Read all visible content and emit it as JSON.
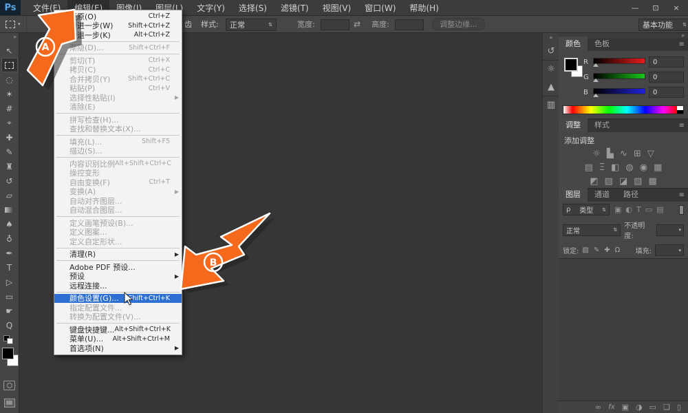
{
  "colors": {
    "accent_orange": "#f4691b",
    "menu_highlight": "#2e6fd2",
    "ui_dark": "#3c3c3c"
  },
  "titlebar": {
    "logo": "Ps",
    "menus": [
      {
        "label": "文件(F)",
        "cls": ""
      },
      {
        "label": "编辑(E)",
        "cls": "active"
      },
      {
        "label": "图像(I)",
        "cls": ""
      },
      {
        "label": "图层(L)",
        "cls": ""
      },
      {
        "label": "文字(Y)",
        "cls": ""
      },
      {
        "label": "选择(S)",
        "cls": ""
      },
      {
        "label": "滤镜(T)",
        "cls": ""
      },
      {
        "label": "视图(V)",
        "cls": ""
      },
      {
        "label": "窗口(W)",
        "cls": ""
      },
      {
        "label": "帮助(H)",
        "cls": ""
      }
    ],
    "minimize": "—",
    "restore": "⊡",
    "close": "×"
  },
  "options_bar": {
    "antialias_fragment": "齿",
    "style_label": "样式:",
    "style_value": "正常",
    "width_label": "宽度:",
    "height_label": "高度:",
    "swap_icon": "⇄",
    "refine_edge_button": "调整边缘...",
    "workspace_value": "基本功能",
    "select_arrows": "⇅",
    "dropdown_arrow": "▾"
  },
  "toolbar": {
    "collapse_glyph": "»",
    "tools": [
      {
        "name": "move-tool",
        "glyph": "↖",
        "cls": ""
      },
      {
        "name": "rectangular-marquee-tool",
        "glyph": "",
        "cls": "marquee selected"
      },
      {
        "name": "lasso-tool",
        "glyph": "◌",
        "cls": ""
      },
      {
        "name": "quick-selection-tool",
        "glyph": "✶",
        "cls": ""
      },
      {
        "name": "crop-tool",
        "glyph": "#",
        "cls": ""
      },
      {
        "name": "eyedropper-tool",
        "glyph": "⌖",
        "cls": ""
      },
      {
        "name": "spot-healing-brush-tool",
        "glyph": "✚",
        "cls": ""
      },
      {
        "name": "brush-tool",
        "glyph": "✎",
        "cls": ""
      },
      {
        "name": "clone-stamp-tool",
        "glyph": "♜",
        "cls": ""
      },
      {
        "name": "history-brush-tool",
        "glyph": "↺",
        "cls": ""
      },
      {
        "name": "eraser-tool",
        "glyph": "▱",
        "cls": ""
      },
      {
        "name": "gradient-tool",
        "glyph": "",
        "cls": "gradient"
      },
      {
        "name": "blur-tool",
        "glyph": "♠",
        "cls": ""
      },
      {
        "name": "dodge-tool",
        "glyph": "♁",
        "cls": ""
      },
      {
        "name": "pen-tool",
        "glyph": "✒",
        "cls": ""
      },
      {
        "name": "type-tool",
        "glyph": "T",
        "cls": ""
      },
      {
        "name": "path-selection-tool",
        "glyph": "▷",
        "cls": ""
      },
      {
        "name": "rectangle-tool",
        "glyph": "▭",
        "cls": ""
      },
      {
        "name": "hand-tool",
        "glyph": "☛",
        "cls": ""
      },
      {
        "name": "zoom-tool",
        "glyph": "Q",
        "cls": ""
      }
    ]
  },
  "edit_menu": {
    "items": [
      {
        "label": "还原(O)",
        "shortcut": "Ctrl+Z",
        "sub": "",
        "cls": ""
      },
      {
        "label": "前进一步(W)",
        "shortcut": "Shift+Ctrl+Z",
        "sub": "",
        "cls": ""
      },
      {
        "label": "后退一步(K)",
        "shortcut": "Alt+Ctrl+Z",
        "sub": "",
        "cls": ""
      },
      {
        "label": "渐隐(D)...",
        "shortcut": "Shift+Ctrl+F",
        "sub": "",
        "cls": "disabled sep"
      },
      {
        "label": "剪切(T)",
        "shortcut": "Ctrl+X",
        "sub": "",
        "cls": "disabled sep"
      },
      {
        "label": "拷贝(C)",
        "shortcut": "Ctrl+C",
        "sub": "",
        "cls": "disabled"
      },
      {
        "label": "合并拷贝(Y)",
        "shortcut": "Shift+Ctrl+C",
        "sub": "",
        "cls": "disabled"
      },
      {
        "label": "粘贴(P)",
        "shortcut": "Ctrl+V",
        "sub": "",
        "cls": "disabled"
      },
      {
        "label": "选择性粘贴(I)",
        "shortcut": "",
        "sub": "▶",
        "cls": "disabled"
      },
      {
        "label": "清除(E)",
        "shortcut": "",
        "sub": "",
        "cls": "disabled"
      },
      {
        "label": "拼写检查(H)...",
        "shortcut": "",
        "sub": "",
        "cls": "disabled sep"
      },
      {
        "label": "查找和替换文本(X)...",
        "shortcut": "",
        "sub": "",
        "cls": "disabled"
      },
      {
        "label": "填充(L)...",
        "shortcut": "Shift+F5",
        "sub": "",
        "cls": "disabled sep"
      },
      {
        "label": "描边(S)...",
        "shortcut": "",
        "sub": "",
        "cls": "disabled"
      },
      {
        "label": "内容识别比例",
        "shortcut": "Alt+Shift+Ctrl+C",
        "sub": "",
        "cls": "disabled sep"
      },
      {
        "label": "操控变形",
        "shortcut": "",
        "sub": "",
        "cls": "disabled"
      },
      {
        "label": "自由变换(F)",
        "shortcut": "Ctrl+T",
        "sub": "",
        "cls": "disabled"
      },
      {
        "label": "变换(A)",
        "shortcut": "",
        "sub": "▶",
        "cls": "disabled"
      },
      {
        "label": "自动对齐图层...",
        "shortcut": "",
        "sub": "",
        "cls": "disabled"
      },
      {
        "label": "自动混合图层...",
        "shortcut": "",
        "sub": "",
        "cls": "disabled"
      },
      {
        "label": "定义画笔预设(B)...",
        "shortcut": "",
        "sub": "",
        "cls": "disabled sep"
      },
      {
        "label": "定义图案...",
        "shortcut": "",
        "sub": "",
        "cls": "disabled"
      },
      {
        "label": "定义自定形状...",
        "shortcut": "",
        "sub": "",
        "cls": "disabled"
      },
      {
        "label": "清理(R)",
        "shortcut": "",
        "sub": "▶",
        "cls": "sep"
      },
      {
        "label": "Adobe PDF 预设...",
        "shortcut": "",
        "sub": "",
        "cls": "sep"
      },
      {
        "label": "预设",
        "shortcut": "",
        "sub": "▶",
        "cls": ""
      },
      {
        "label": "远程连接...",
        "shortcut": "",
        "sub": "",
        "cls": ""
      },
      {
        "label": "颜色设置(G)...",
        "shortcut": "Shift+Ctrl+K",
        "sub": "",
        "cls": "highlight sep"
      },
      {
        "label": "指定配置文件...",
        "shortcut": "",
        "sub": "",
        "cls": "disabled"
      },
      {
        "label": "转换为配置文件(V)...",
        "shortcut": "",
        "sub": "",
        "cls": "disabled"
      },
      {
        "label": "键盘快捷键...",
        "shortcut": "Alt+Shift+Ctrl+K",
        "sub": "",
        "cls": "sep"
      },
      {
        "label": "菜单(U)...",
        "shortcut": "Alt+Shift+Ctrl+M",
        "sub": "",
        "cls": ""
      },
      {
        "label": "首选项(N)",
        "shortcut": "",
        "sub": "▶",
        "cls": ""
      }
    ]
  },
  "dock_strip": {
    "collapse_glyph": "«",
    "icons": [
      {
        "name": "history-panel-icon",
        "glyph": "↺",
        "cls": ""
      },
      {
        "name": "properties-panel-icon",
        "glyph": "☼",
        "cls": "sep-top"
      },
      {
        "name": "histogram-panel-icon",
        "glyph": "▲",
        "cls": ""
      },
      {
        "name": "info-panel-icon",
        "glyph": "▥",
        "cls": "sep-top"
      }
    ]
  },
  "panels": {
    "dock_collapse_glyph": "»",
    "panel_menu_glyph": "≡",
    "color": {
      "tab_color": "颜色",
      "tab_swatches": "色板",
      "channels": [
        {
          "ch": "R",
          "value": "0",
          "cls": "r"
        },
        {
          "ch": "G",
          "value": "0",
          "cls": "g"
        },
        {
          "ch": "B",
          "value": "0",
          "cls": "b"
        }
      ]
    },
    "adjustments": {
      "tab_adjustments": "调整",
      "tab_styles": "样式",
      "add_label": "添加调整",
      "row1": [
        {
          "name": "brightness-contrast-icon",
          "glyph": "☼"
        },
        {
          "name": "levels-icon",
          "glyph": "▙"
        },
        {
          "name": "curves-icon",
          "glyph": "∿"
        },
        {
          "name": "exposure-icon",
          "glyph": "⊞"
        },
        {
          "name": "vibrance-icon",
          "glyph": "▽"
        }
      ],
      "row2": [
        {
          "name": "hue-saturation-icon",
          "glyph": "▤"
        },
        {
          "name": "color-balance-icon",
          "glyph": "Ξ"
        },
        {
          "name": "black-white-icon",
          "glyph": "◧"
        },
        {
          "name": "photo-filter-icon",
          "glyph": "◍"
        },
        {
          "name": "channel-mixer-icon",
          "glyph": "◉"
        },
        {
          "name": "color-lookup-icon",
          "glyph": "▦"
        }
      ],
      "row3": [
        {
          "name": "invert-icon",
          "glyph": "◩"
        },
        {
          "name": "posterize-icon",
          "glyph": "▨"
        },
        {
          "name": "threshold-icon",
          "glyph": "◪"
        },
        {
          "name": "gradient-map-icon",
          "glyph": "▧"
        },
        {
          "name": "selective-color-icon",
          "glyph": "▩"
        }
      ]
    },
    "layers": {
      "tab_layers": "图层",
      "tab_channels": "通道",
      "tab_paths": "路径",
      "filter_label": "类型",
      "filter_search_glyph": "ρ",
      "filter_icons": [
        {
          "name": "filter-pixel-layers-icon",
          "glyph": "▣"
        },
        {
          "name": "filter-adjustment-layers-icon",
          "glyph": "◐"
        },
        {
          "name": "filter-type-layers-icon",
          "glyph": "T"
        },
        {
          "name": "filter-shape-layers-icon",
          "glyph": "▭"
        },
        {
          "name": "filter-smart-objects-icon",
          "glyph": "▤"
        }
      ],
      "blend_mode": "正常",
      "opacity_label": "不透明度:",
      "lock_label": "锁定:",
      "lock_icons": [
        {
          "name": "lock-transparent-pixels-icon",
          "glyph": "▨"
        },
        {
          "name": "lock-image-pixels-icon",
          "glyph": "✎"
        },
        {
          "name": "lock-position-icon",
          "glyph": "✚"
        },
        {
          "name": "lock-all-icon",
          "glyph": "Ω"
        }
      ],
      "fill_label": "填充:",
      "footer_icons": [
        {
          "name": "link-layers-icon",
          "glyph": "∞",
          "cls": ""
        },
        {
          "name": "layer-style-icon",
          "glyph": "fx",
          "cls": "fx"
        },
        {
          "name": "layer-mask-icon",
          "glyph": "▣",
          "cls": ""
        },
        {
          "name": "adjustment-layer-icon",
          "glyph": "◑",
          "cls": ""
        },
        {
          "name": "new-group-icon",
          "glyph": "▭",
          "cls": ""
        },
        {
          "name": "new-layer-icon",
          "glyph": "❏",
          "cls": ""
        },
        {
          "name": "delete-layer-icon",
          "glyph": "▯",
          "cls": ""
        }
      ]
    }
  },
  "arrows": {
    "a": "A",
    "b": "B"
  }
}
